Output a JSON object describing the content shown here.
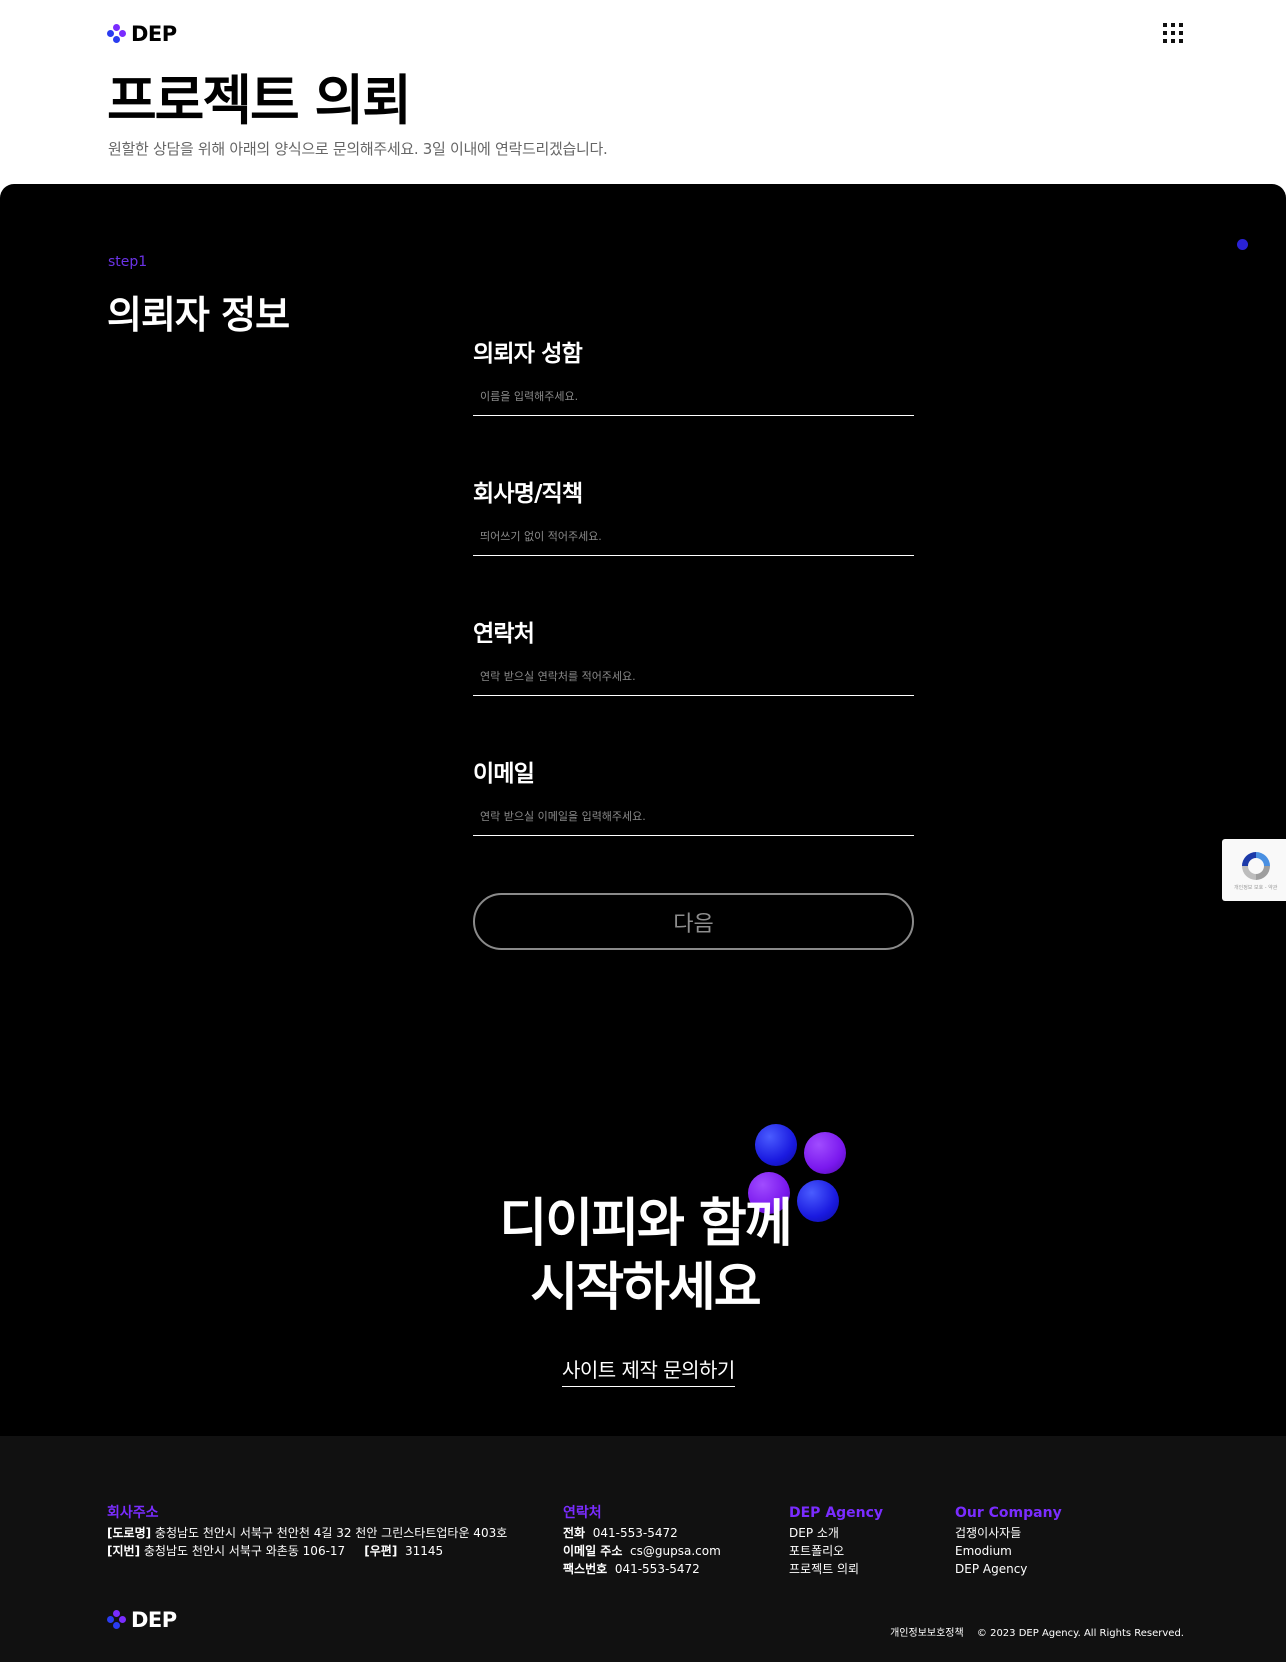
{
  "header": {
    "logo_text": "DEP",
    "title": "프로젝트 의뢰",
    "subtitle": "원할한 상담을 위해 아래의 양식으로 문의해주세요. 3일 이내에 연락드리겠습니다."
  },
  "colors": {
    "accent_purple": "#6b33e6",
    "accent_blue": "#2a22d6",
    "logo_blue": "#2a3cf0",
    "logo_purple": "#7a2cff"
  },
  "icons": {
    "logo": "dep-logo-icon",
    "menu": "grid-menu-icon",
    "recaptcha": "recaptcha-icon"
  },
  "form": {
    "step": "step1",
    "section_title": "의뢰자 정보",
    "fields": [
      {
        "label": "의뢰자 성함",
        "placeholder": "이름을 입력해주세요.",
        "value": ""
      },
      {
        "label": "회사명/직책",
        "placeholder": "띄어쓰기 없이 적어주세요.",
        "value": ""
      },
      {
        "label": "연락처",
        "placeholder": "연락 받으실 연락처를 적어주세요.",
        "value": ""
      },
      {
        "label": "이메일",
        "placeholder": "연락 받으실 이메일을 입력해주세요.",
        "value": ""
      }
    ],
    "next_label": "다음"
  },
  "recaptcha": {
    "text": "개인정보 보호 - 약관"
  },
  "cta": {
    "line1": "디이피와 함께",
    "line2": "시작하세요",
    "link": "사이트 제작 문의하기"
  },
  "footer": {
    "address": {
      "heading": "회사주소",
      "road_tag": "[도로명]",
      "road": "충청남도 천안시 서북구 천안천 4길 32 천안 그린스타트업타운 403호",
      "lot_tag": "[지번]",
      "lot": "충청남도 천안시 서북구 와촌동 106-17",
      "zip_tag": "[우편]",
      "zip": "31145"
    },
    "contact": {
      "heading": "연락처",
      "phone_tag": "전화",
      "phone": "041-553-5472",
      "email_tag": "이메일 주소",
      "email": "cs@gupsa.com",
      "fax_tag": "팩스번호",
      "fax": "041-553-5472"
    },
    "agency": {
      "heading": "DEP Agency",
      "links": [
        "DEP 소개",
        "포트폴리오",
        "프로젝트 의뢰"
      ]
    },
    "company": {
      "heading": "Our Company",
      "links": [
        "겁쟁이사자들",
        "Emodium",
        "DEP Agency"
      ]
    },
    "logo_text": "DEP",
    "privacy": "개인정보보호정책",
    "copyright": "© 2023 DEP Agency. All Rights Reserved."
  }
}
